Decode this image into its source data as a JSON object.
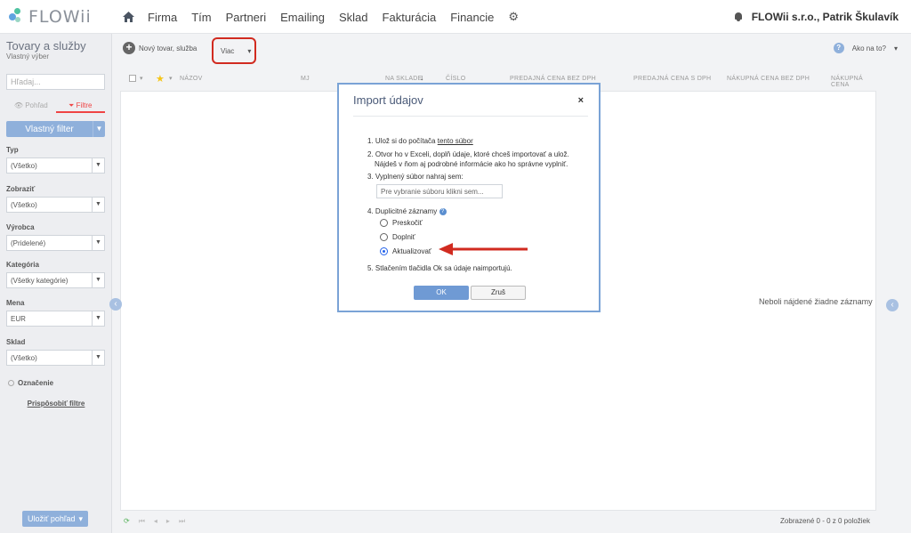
{
  "app": {
    "logo_text": "FLOWii"
  },
  "nav": {
    "items": [
      "Firma",
      "Tím",
      "Partneri",
      "Emailing",
      "Sklad",
      "Fakturácia",
      "Financie"
    ],
    "user": "FLOWii s.r.o., Patrik Škulavík"
  },
  "sidebar": {
    "title": "Tovary a služby",
    "subtitle": "Vlastný výber",
    "search_placeholder": "Hľadaj...",
    "tab_view": "Pohľad",
    "tab_filters": "Filtre",
    "custom_filter": "Vlastný filter",
    "filters": [
      {
        "label": "Typ",
        "value": "(Všetko)"
      },
      {
        "label": "Zobraziť",
        "value": "(Všetko)"
      },
      {
        "label": "Výrobca",
        "value": "(Pridelené)"
      },
      {
        "label": "Kategória",
        "value": "(Všetky kategórie)"
      },
      {
        "label": "Mena",
        "value": "EUR"
      },
      {
        "label": "Sklad",
        "value": "(Všetko)"
      }
    ],
    "marking": "Označenie",
    "customize": "Prispôsobiť filtre",
    "save_view": "Uložiť pohľad"
  },
  "toolbar": {
    "new_item": "Nový tovar, služba",
    "more": "Viac",
    "help": "Ako na to?"
  },
  "table": {
    "columns": [
      "NÁZOV",
      "MJ",
      "NA SKLADE",
      "ČÍSLO",
      "PREDAJNÁ CENA BEZ DPH",
      "PREDAJNÁ CENA S DPH",
      "NÁKUPNÁ CENA BEZ DPH",
      "NÁKUPNÁ CENA"
    ],
    "empty_message": "Neboli nájdené žiadne záznamy",
    "displayed": "Zobrazené 0 - 0 z 0 položiek"
  },
  "modal": {
    "title": "Import údajov",
    "close": "×",
    "step1_prefix": "1. Ulož si do počítača",
    "step1_link": "tento súbor",
    "step2_line1": "2. Otvor ho v Exceli, doplň údaje, ktoré chceš importovať a ulož.",
    "step2_line2": "Nájdeš v ňom aj podrobné informácie ako ho správne vyplniť.",
    "step3": "3. Vyplnený súbor nahraj sem:",
    "file_placeholder": "Pre vybranie súboru klikni sem...",
    "step4": "4. Duplicitné záznamy",
    "options": [
      "Preskočiť",
      "Doplniť",
      "Aktualizovať"
    ],
    "selected_option": "Aktualizovať",
    "step5": "5. Stlačením tlačidla Ok sa údaje naimportujú.",
    "ok": "OK",
    "cancel": "Zruš"
  },
  "colors": {
    "accent": "#8fb0db",
    "highlight": "#d12b20",
    "modal_border": "#7aa3d6"
  }
}
